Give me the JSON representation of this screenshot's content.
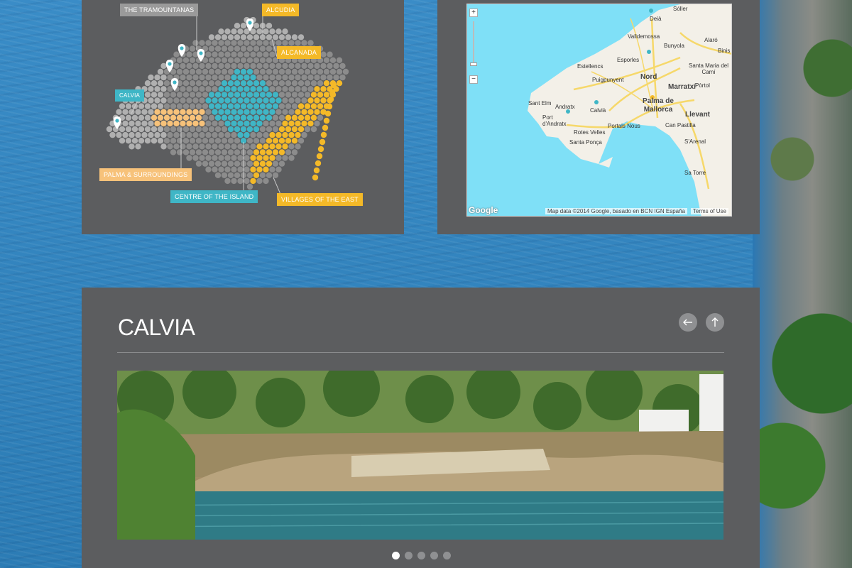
{
  "island_map": {
    "regions": {
      "tramountanas": "THE TRAMOUNTANAS",
      "alcudia": "ALCUDIA",
      "alcanada": "ALCANADA",
      "calvia": "CALVIA",
      "palma": "PALMA & SURROUNDINGS",
      "centre": "CENTRE OF THE ISLAND",
      "villages_east": "VILLAGES OF THE EAST"
    },
    "colors": {
      "panel": "#5c5d5f",
      "hex_grey": "#8c8c8c",
      "hex_light": "#b0b0b0",
      "teal": "#3fb6c6",
      "yellow": "#f4b928",
      "peach": "#f7c27a"
    }
  },
  "google_map": {
    "zoom_in": "+",
    "zoom_out": "−",
    "places": {
      "soller": "Sóller",
      "deia": "Deià",
      "valldemossa": "Valldemossa",
      "alaro": "Alaró",
      "bunyola": "Bunyola",
      "binis": "Binis",
      "estellencs": "Estellencs",
      "esporles": "Esporles",
      "santa_maria": "Santa Maria del Camí",
      "puigpunyent": "Puigpunyent",
      "nord": "Nord",
      "marratxi": "Marratxí",
      "portol": "Pòrtol",
      "sant_elm": "Sant Elm",
      "andratx": "Andratx",
      "calvia": "Calvià",
      "palma": "Palma de Mallorca",
      "llevant": "Llevant",
      "port_andratx": "Port d'Andratx",
      "portals_nous": "Portals Nous",
      "can_pastilla": "Can Pastilla",
      "rotes_velles": "Rotes Velles",
      "santa_ponca": "Santa Ponça",
      "sarenal": "S'Arenal",
      "sa_torre": "Sa Torre"
    },
    "logo": "Google",
    "attribution": "Map data ©2014 Google, basado en BCN IGN España",
    "terms": "Terms of Use",
    "colors": {
      "sea": "#7fe0f7",
      "land": "#f3f0e8",
      "roads": "#f6d86a"
    }
  },
  "gallery": {
    "title": "CALVIA",
    "prev_icon": "arrow-left-icon",
    "up_icon": "arrow-up-icon",
    "slide_count": 5,
    "active_slide": 1
  }
}
